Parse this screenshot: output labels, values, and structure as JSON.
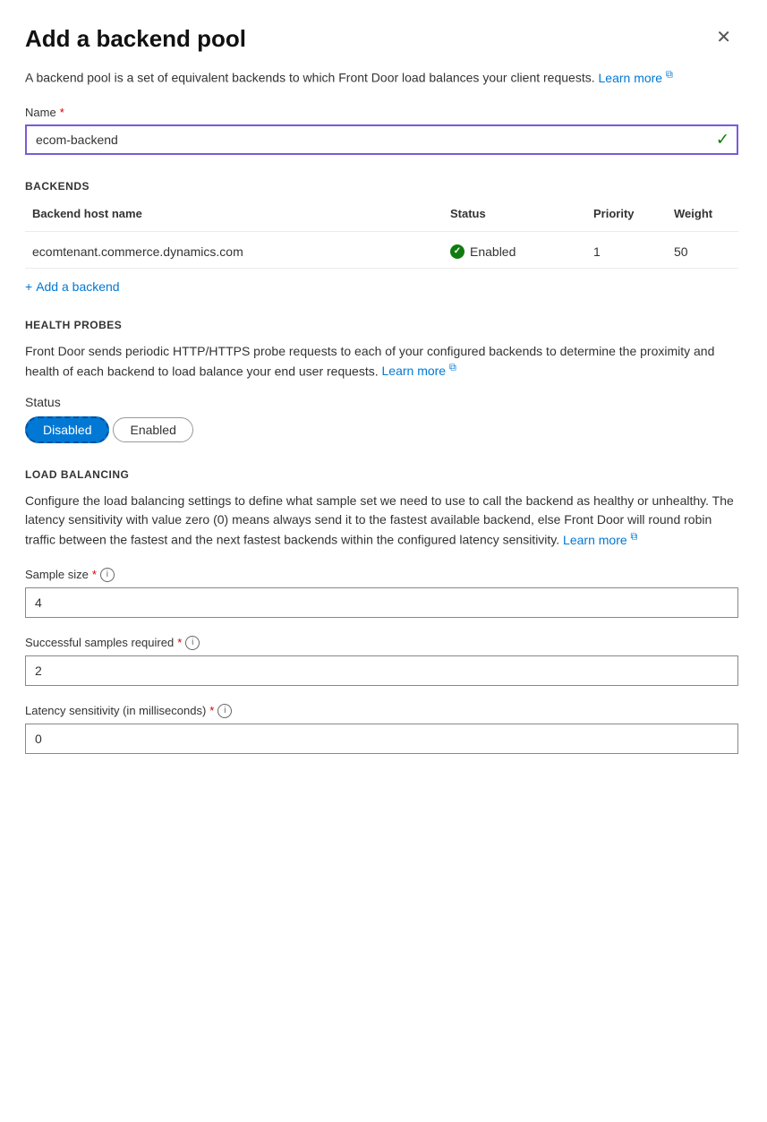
{
  "panel": {
    "title": "Add a backend pool",
    "close_label": "×"
  },
  "description": {
    "text": "A backend pool is a set of equivalent backends to which Front Door load balances your client requests.",
    "link_text": "Learn more",
    "link_icon": "↗"
  },
  "name_field": {
    "label": "Name",
    "required": true,
    "value": "ecom-backend",
    "check_icon": "✓"
  },
  "backends_section": {
    "header": "BACKENDS",
    "columns": {
      "host": "Backend host name",
      "status": "Status",
      "priority": "Priority",
      "weight": "Weight"
    },
    "rows": [
      {
        "host": "ecomtenant.commerce.dynamics.com",
        "status": "Enabled",
        "priority": "1",
        "weight": "50"
      }
    ],
    "add_label": "Add a backend"
  },
  "health_probes_section": {
    "header": "HEALTH PROBES",
    "description": "Front Door sends periodic HTTP/HTTPS probe requests to each of your configured backends to determine the proximity and health of each backend to load balance your end user requests.",
    "link_text": "Learn more",
    "link_icon": "↗",
    "status_label": "Status",
    "toggle_disabled": "Disabled",
    "toggle_enabled": "Enabled"
  },
  "load_balancing_section": {
    "header": "LOAD BALANCING",
    "description": "Configure the load balancing settings to define what sample set we need to use to call the backend as healthy or unhealthy. The latency sensitivity with value zero (0) means always send it to the fastest available backend, else Front Door will round robin traffic between the fastest and the next fastest backends within the configured latency sensitivity.",
    "link_text": "Learn more",
    "link_icon": "↗",
    "sample_size": {
      "label": "Sample size",
      "required": true,
      "value": "4"
    },
    "successful_samples": {
      "label": "Successful samples required",
      "required": true,
      "value": "2"
    },
    "latency_sensitivity": {
      "label": "Latency sensitivity (in milliseconds)",
      "required": true,
      "value": "0"
    }
  }
}
